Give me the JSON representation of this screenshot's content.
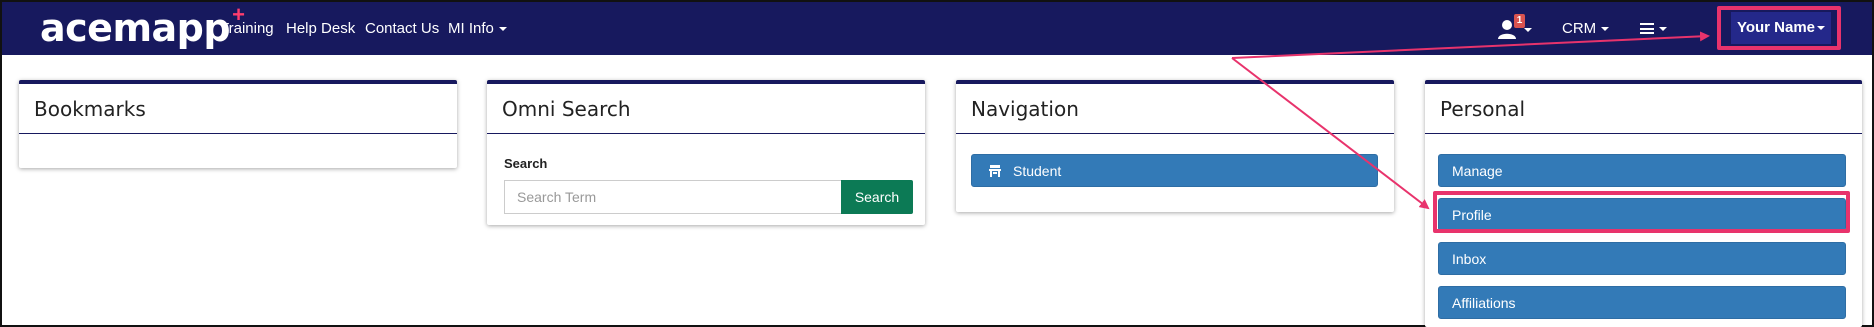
{
  "navbar": {
    "brand": "acemapp",
    "brand_mark": "+",
    "links": [
      "Training",
      "Help Desk",
      "Contact Us",
      "MI Info"
    ],
    "notification_count": "1",
    "crm_label": "CRM",
    "user_menu_label": "Your Name",
    "colors": {
      "background": "#17195e",
      "badge": "#d9534f"
    }
  },
  "panels": {
    "bookmarks": {
      "title": "Bookmarks"
    },
    "omni_search": {
      "title": "Omni Search",
      "search_label": "Search",
      "search_placeholder": "Search Term",
      "search_button": "Search"
    },
    "navigation": {
      "title": "Navigation",
      "items": [
        {
          "label": "Student",
          "icon": "student-icon"
        }
      ]
    },
    "personal": {
      "title": "Personal",
      "items": [
        {
          "label": "Manage"
        },
        {
          "label": "Profile"
        },
        {
          "label": "Inbox"
        },
        {
          "label": "Affiliations"
        }
      ]
    }
  },
  "annotations": {
    "highlight_color": "#e8336c",
    "highlighted": [
      "Your Name",
      "Profile"
    ]
  }
}
